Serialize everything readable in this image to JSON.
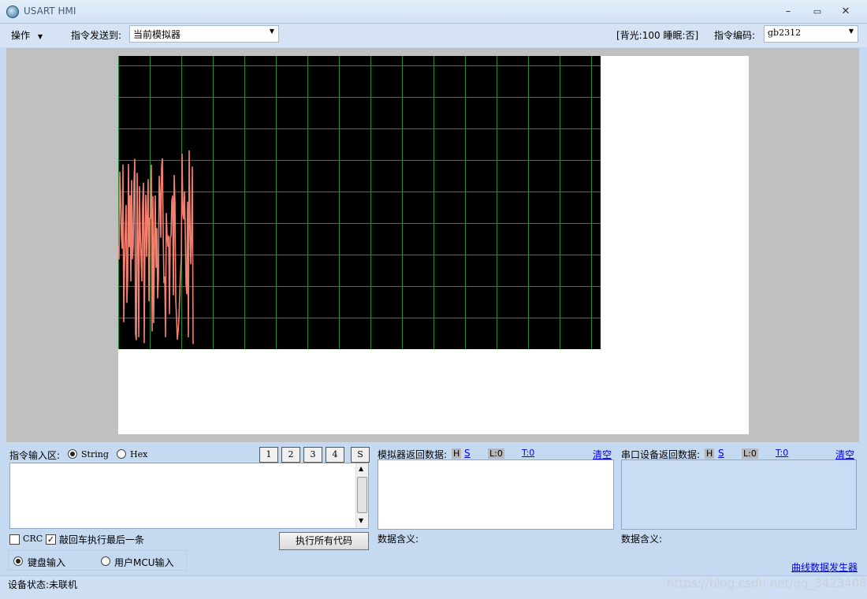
{
  "window": {
    "title": "USART HMI",
    "min": "–",
    "max": "▭",
    "close": "✕"
  },
  "toolbar": {
    "menu_label": "操作",
    "send_to_label": "指令发送到:",
    "send_to_value": "当前模拟器",
    "status_text": "[背光:100  睡眠:否]",
    "encoding_label": "指令编码:",
    "encoding_value": "gb2312"
  },
  "colors": {
    "grid": "#1f8a2a",
    "trace": "#f08070",
    "screen_bg": "#000000"
  },
  "command_area": {
    "label": "指令输入区:",
    "mode_string": "String",
    "mode_hex": "Hex",
    "mode_selected": "String",
    "slot_buttons": [
      "1",
      "2",
      "3",
      "4",
      "S"
    ],
    "input_value": "",
    "crc_label": "CRC",
    "crc_checked": false,
    "enter_exec_label": "敲回车执行最后一条",
    "enter_exec_checked": true,
    "run_all_label": "执行所有代码",
    "input_keyboard_label": "键盘输入",
    "input_mcu_label": "用户MCU输入",
    "input_selected": "键盘输入"
  },
  "sim_return": {
    "label": "模拟器返回数据:",
    "h": "H",
    "s": "S",
    "l": "L:0",
    "t": "T:0",
    "clear": "清空",
    "meaning_label": "数据含义:"
  },
  "serial_return": {
    "label": "串口设备返回数据:",
    "h": "H",
    "s": "S",
    "l": "L:0",
    "t": "T:0",
    "clear": "清空",
    "meaning_label": "数据含义:"
  },
  "curve_generator_link": "曲线数据发生器",
  "status": {
    "device_status": "设备状态:未联机",
    "watermark": "https://blog.csdn.net/qq_34234087"
  }
}
